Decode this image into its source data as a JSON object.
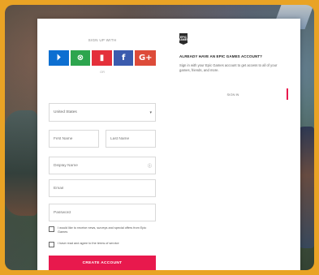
{
  "form": {
    "sign_up_with": "SIGN UP WITH",
    "socials": [
      {
        "icon": "playstation-icon",
        "glyph": "⏵",
        "color": "#0d6fd1"
      },
      {
        "icon": "xbox-icon",
        "glyph": "⊗",
        "color": "#2da54e"
      },
      {
        "icon": "nintendo-icon",
        "glyph": "▮",
        "color": "#e4303a"
      },
      {
        "icon": "facebook-icon",
        "glyph": "f",
        "color": "#3b5bae"
      },
      {
        "icon": "google-plus-icon",
        "glyph": "G+",
        "color": "#dd4b39"
      }
    ],
    "or_label": "OR",
    "country_value": "United States",
    "first_name_placeholder": "First Name",
    "last_name_placeholder": "Last Name",
    "display_name_placeholder": "Display Name",
    "email_placeholder": "Email",
    "password_placeholder": "Password",
    "checkbox_news": "I would like to receive news, surveys and special offers from Epic Games",
    "checkbox_terms": "I have read and agree to the terms of service",
    "submit_label": "CREATE ACCOUNT"
  },
  "right_panel": {
    "logo_text": "EPIC GAMES",
    "heading": "ALREADY HAVE AN EPIC GAMES ACCOUNT?",
    "text": "Sign in with your Epic Games account to get access to all of your games, friends, and more.",
    "link_label": "SIGN IN"
  },
  "colors": {
    "accent": "#e8194d",
    "frame": "#e9a325"
  }
}
